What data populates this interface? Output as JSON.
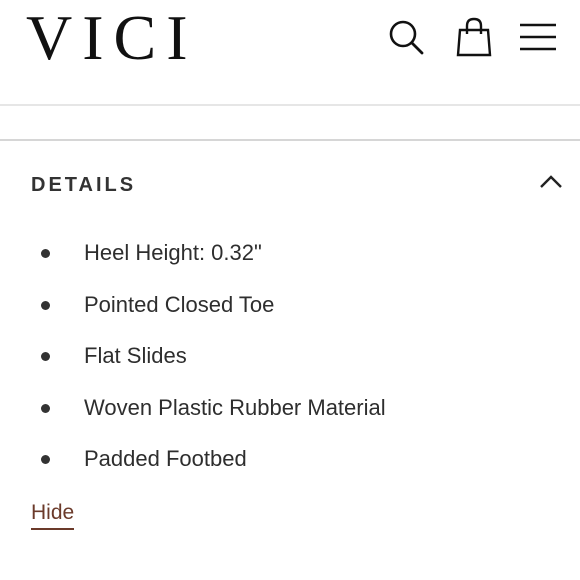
{
  "header": {
    "logo": "VICI",
    "icons": {
      "search": "search-icon",
      "bag": "shopping-bag-icon",
      "menu": "hamburger-menu-icon"
    }
  },
  "details": {
    "title": "DETAILS",
    "expanded": true,
    "toggle_icon": "chevron-up-icon",
    "items": [
      "Heel Height: 0.32\"",
      "Pointed Closed Toe",
      "Flat Slides",
      "Woven Plastic Rubber Material",
      "Padded Footbed"
    ],
    "hide_label": "Hide"
  },
  "colors": {
    "link": "#6b3a2a",
    "text": "#2e2e2e",
    "divider": "#d6d6d6"
  }
}
